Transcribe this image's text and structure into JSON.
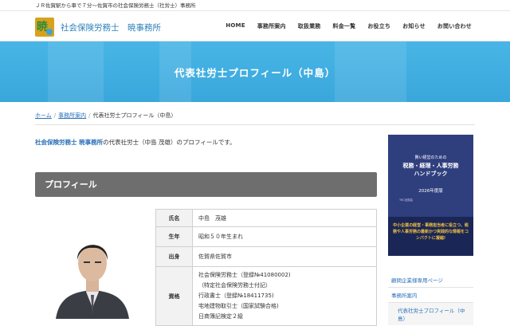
{
  "topbar": {
    "tagline": "ＪＲ佐賀駅から車で７分～佐賀市の社会保険労務士（社労士）事務所"
  },
  "header": {
    "site_name": "社会保険労務士　暁事務所",
    "nav": [
      "HOME",
      "事務所案内",
      "取扱業務",
      "料金一覧",
      "お役立ち",
      "お知らせ",
      "お問い合わせ"
    ]
  },
  "hero": {
    "title": "代表社労士プロフィール（中島）"
  },
  "breadcrumb": {
    "home": "ホーム",
    "office": "事務所案内",
    "current": "代表社労士プロフィール（中島）"
  },
  "intro": {
    "org": "社会保険労務士 暁事務所",
    "text": "の代表社労士（中島 茂雄）のプロフィールです。"
  },
  "section": {
    "title": "プロフィール"
  },
  "profile": {
    "rows": [
      {
        "label": "氏名",
        "value": "中島　茂雄"
      },
      {
        "label": "生年",
        "value": "昭和５０年生まれ"
      },
      {
        "label": "出身",
        "value": "佐賀県佐賀市"
      }
    ],
    "qual_label": "資格",
    "qualifications": [
      "社会保険労務士（登録№41080002)",
      "（特定社会保険労務士付記）",
      "行政書士（登録№18411735)",
      "宅地建物取引士（国家試験合格)",
      "日商簿記検定２級"
    ]
  },
  "sidebar": {
    "book": {
      "line1": "賢い経営のための",
      "line2": "税務・経理・人事労務",
      "line3": "ハンドブック",
      "line4": "2026年度版",
      "publisher": "TKC全国会",
      "promo": "中小企業の経営・事務担当者に役立つ、税務や人事労務の最新かつ実践的な情報をコンパクトに凝縮!"
    },
    "links": [
      "顧問企業様専用ページ",
      "事務所案内",
      "代表社労士プロフィール（中島）"
    ]
  },
  "colors": {
    "accent": "#2a7fb8",
    "hero": "#45b2e4",
    "section_head": "#6e6e6e"
  }
}
